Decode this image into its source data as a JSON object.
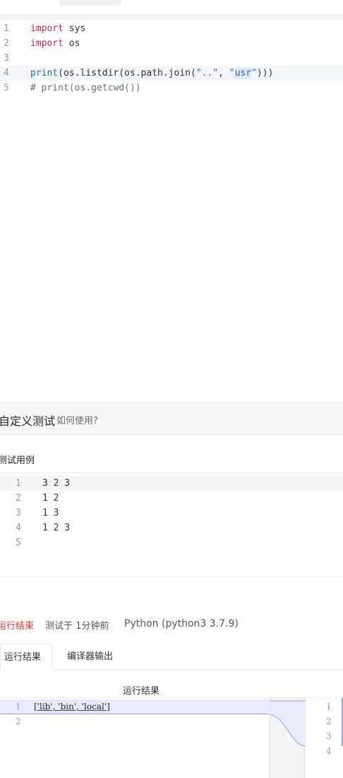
{
  "editor": {
    "line_numbers": [
      "1",
      "2",
      "3",
      "4",
      "5"
    ],
    "line1": {
      "kw": "import",
      "rest": " sys"
    },
    "line2": {
      "kw": "import",
      "rest": " os"
    },
    "line4": {
      "fn": "print",
      "a": "(os.listdir(os.path.join(",
      "s1": "\"..\"",
      "b": ", ",
      "s2": "\"",
      "s3": "usr",
      "s4": "\"",
      "c": ")))"
    },
    "line5": {
      "comment": "# print(os.getcwd())"
    }
  },
  "custom_test": {
    "title": "自定义测试",
    "help_link": "如何使用?",
    "cases_label": "测试用例",
    "line_numbers": [
      "1",
      "2",
      "3",
      "4",
      "5"
    ],
    "lines": [
      "3 2 3",
      "1 2",
      "1 3",
      "1 2 3",
      ""
    ]
  },
  "run_status": {
    "status": "运行结束",
    "time": "测试于 1分钟前",
    "language": "Python (python3 3.7.9)"
  },
  "tabs": [
    "运行结果",
    "编译器输出"
  ],
  "result": {
    "title": "运行结果",
    "left_line_numbers": [
      "1",
      "2"
    ],
    "output_line": "['lib', 'bin', 'local']",
    "right_line_numbers": [
      "1",
      "2",
      "3",
      "4"
    ]
  },
  "colors": {
    "accent_status": "#e03131",
    "diff_highlight": "#eaeafd",
    "diff_border": "#9aa0e8"
  }
}
